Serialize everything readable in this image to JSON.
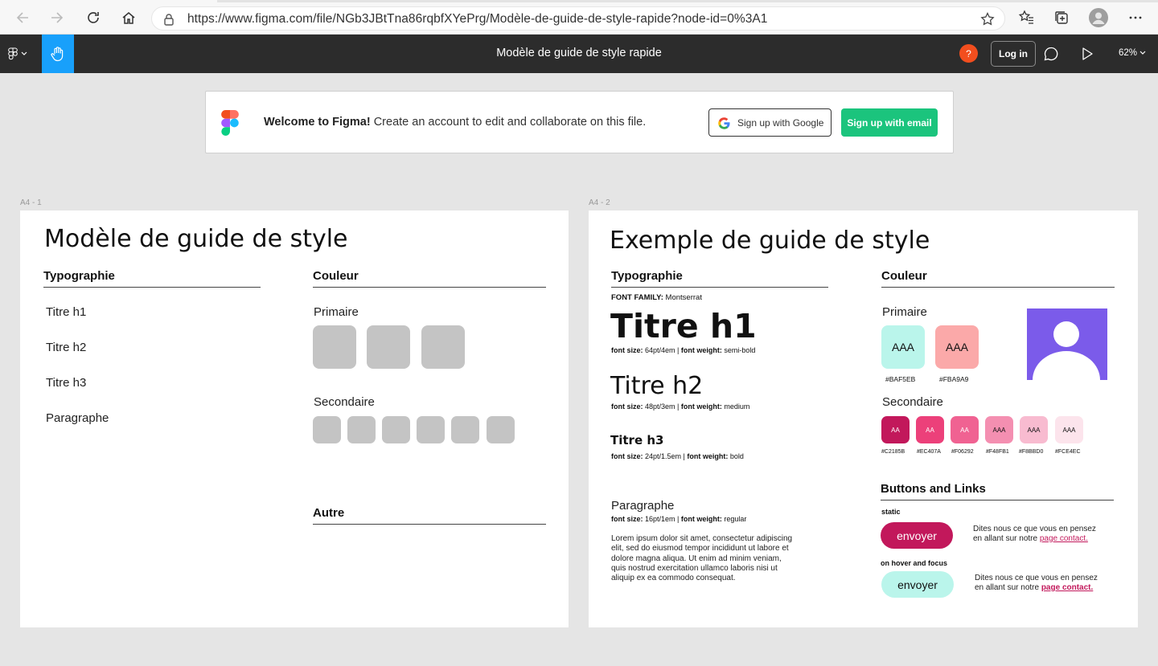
{
  "browser": {
    "url": "https://www.figma.com/file/NGb3JBtTna86rqbfXYePrg/Modèle-de-guide-de-style-rapide?node-id=0%3A1"
  },
  "toolbar": {
    "title": "Modèle de guide de style rapide",
    "help_label": "?",
    "login_label": "Log in",
    "zoom": "62%"
  },
  "banner": {
    "welcome_bold": "Welcome to Figma!",
    "welcome_text": " Create an account to edit and collaborate on this file.",
    "google_label": "Sign up with Google",
    "email_label": "Sign up with email"
  },
  "frame1": {
    "label": "A4 - 1",
    "title": "Modèle de guide de style",
    "typography_head": "Typographie",
    "type_items": [
      "Titre h1",
      "Titre h2",
      "Titre h3",
      "Paragraphe"
    ],
    "color_head": "Couleur",
    "primary_label": "Primaire",
    "secondary_label": "Secondaire",
    "other_head": "Autre"
  },
  "frame2": {
    "label": "A4 - 2",
    "title": "Exemple de guide de style",
    "typography_head": "Typographie",
    "font_family_label": "FONT FAMILY:",
    "font_family_value": " Montserrat",
    "h1": "Titre h1",
    "h1_size_label": "font size:",
    "h1_size": " 64pt/4em | ",
    "h1_weight_label": "font weight:",
    "h1_weight": " semi-bold",
    "h2": "Titre h2",
    "h2_size_label": "font size:",
    "h2_size": " 48pt/3em | ",
    "h2_weight_label": "font weight:",
    "h2_weight": " medium",
    "h3": "Titre h3",
    "h3_size_label": "font size:",
    "h3_size": " 24pt/1.5em | ",
    "h3_weight_label": "font weight:",
    "h3_weight": " bold",
    "para_head": "Paragraphe",
    "p_size_label": "font size:",
    "p_size": " 16pt/1em | ",
    "p_weight_label": "font weight:",
    "p_weight": " regular",
    "lorem": [
      "Lorem ipsum dolor sit amet, consectetur adipiscing",
      "elit, sed do eiusmod tempor incididunt ut labore et",
      "dolore magna aliqua. Ut enim ad minim veniam,",
      "quis nostrud exercitation ullamco laboris nisi ut",
      "aliquip ex ea commodo consequat."
    ],
    "color_head": "Couleur",
    "primary_label": "Primaire",
    "primary_swatches": [
      {
        "text": "AAA",
        "hex": "#BAF5EB",
        "color": "#baf5eb"
      },
      {
        "text": "AAA",
        "hex": "#FBA9A9",
        "color": "#fba9a9"
      }
    ],
    "secondary_label": "Secondaire",
    "secondary_swatches": [
      {
        "text": "AA",
        "hex": "#C2185B",
        "color": "#c2185b",
        "fg": "#ffffff"
      },
      {
        "text": "AA",
        "hex": "#EC407A",
        "color": "#ec407a",
        "fg": "#ffffff"
      },
      {
        "text": "AA",
        "hex": "#F06292",
        "color": "#f06292",
        "fg": "#ffffff"
      },
      {
        "text": "AAA",
        "hex": "#F48FB1",
        "color": "#f48fb1",
        "fg": "#111111"
      },
      {
        "text": "AAA",
        "hex": "#F8BBD0",
        "color": "#f8bbd0",
        "fg": "#111111"
      },
      {
        "text": "AAA",
        "hex": "#FCE4EC",
        "color": "#fce4ec",
        "fg": "#111111"
      }
    ],
    "buttons_head": "Buttons and Links",
    "static_label": "static",
    "hover_label": "on hover and focus",
    "button_text": "envoyer",
    "link_line1": "Dites nous ce que vous en pensez",
    "link_line2": "en allant sur notre ",
    "link_text": "page contact."
  },
  "colors": {
    "accent": "#18a0fb",
    "brand_green": "#1bc47d",
    "avatar_bg": "#7b5bea",
    "primary_btn": "#c2185b",
    "hover_btn": "#baf5eb"
  }
}
